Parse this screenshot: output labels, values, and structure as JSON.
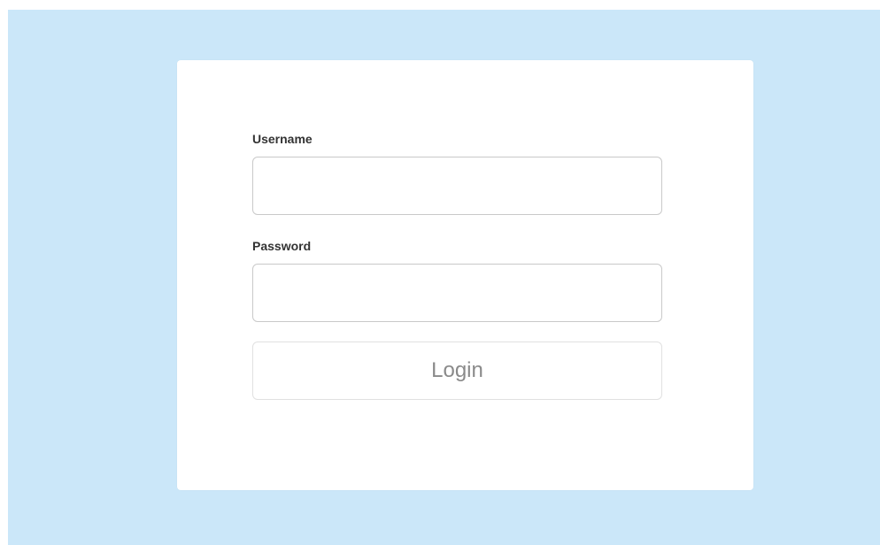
{
  "colors": {
    "page_background": "#cbe7f9",
    "card_background": "#ffffff",
    "label_text": "#333333",
    "button_text": "#8a8a8a"
  },
  "login_form": {
    "username": {
      "label": "Username",
      "value": "",
      "placeholder": ""
    },
    "password": {
      "label": "Password",
      "value": "",
      "placeholder": ""
    },
    "login_button_label": "Login"
  }
}
